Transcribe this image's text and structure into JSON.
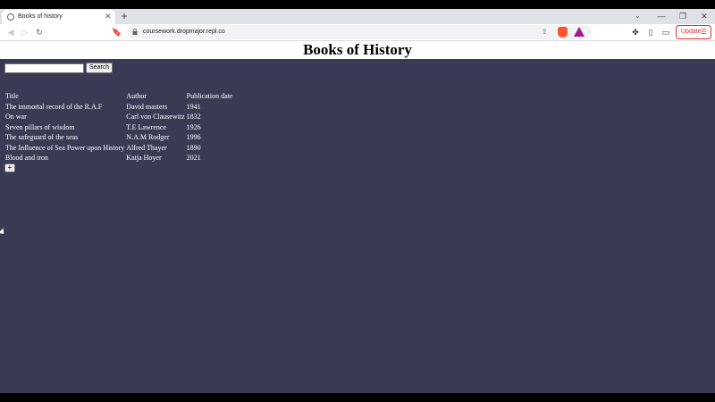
{
  "browser": {
    "tab_title": "Books of history",
    "tab_close": "✕",
    "new_tab": "+",
    "url": "coursework.dropmajor.repl.co",
    "update_label": "Update",
    "window_controls": [
      "—",
      "❐",
      "✕"
    ]
  },
  "page": {
    "heading": "Books of History",
    "search": {
      "value": "",
      "button_label": "Search"
    },
    "table": {
      "headers": [
        "Title",
        "Author",
        "Publication date"
      ],
      "rows": [
        [
          "The immortal record of the R.A.F",
          "David masters",
          "1941"
        ],
        [
          "On war",
          "Carl von Clausewitz",
          "1832"
        ],
        [
          "Seven pillars of wisdom",
          "T.E Lawrence",
          "1926"
        ],
        [
          "The safeguard of the seas",
          "N.A.M Rodger",
          "1996"
        ],
        [
          "The Influence of Sea Power upon History",
          "Alfred Thayer",
          "1890"
        ],
        [
          "Blood and iron",
          "Katja Hoyer",
          "2021"
        ]
      ]
    },
    "add_button_label": "+"
  },
  "colors": {
    "page_bg": "#3a3a55",
    "header_bg": "#ffffff",
    "text": "#ffffff",
    "update_accent": "#d93025"
  }
}
